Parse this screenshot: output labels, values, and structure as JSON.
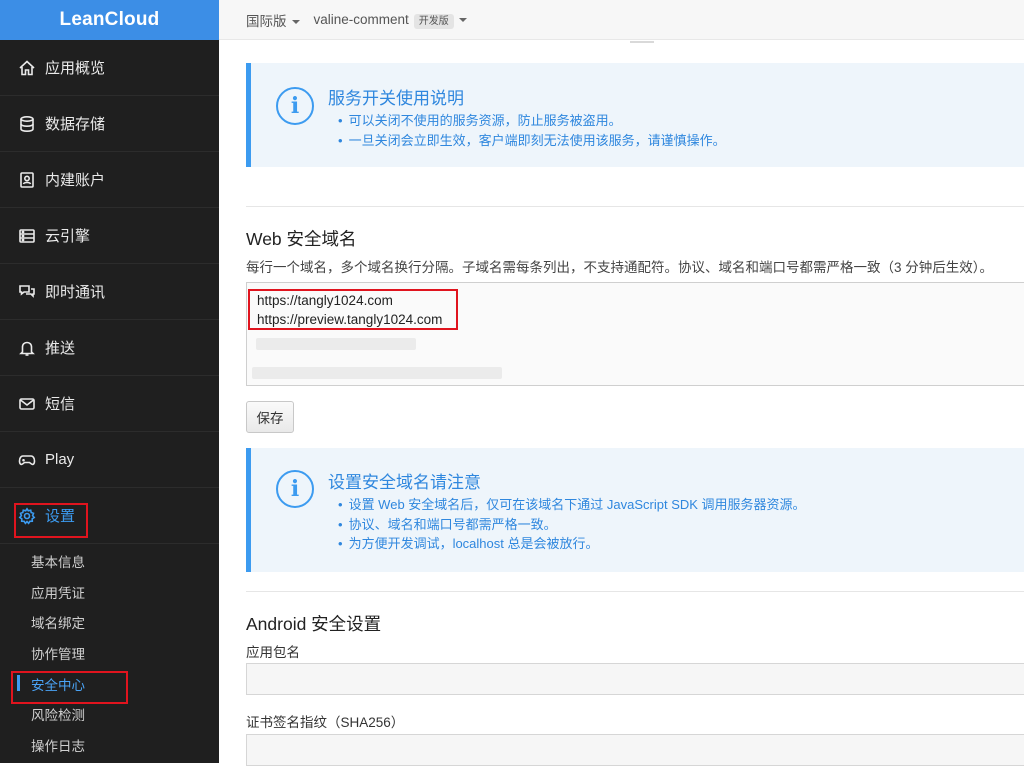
{
  "brand": "LeanCloud",
  "sidebar": {
    "items": [
      {
        "label": "应用概览",
        "icon": "home-icon"
      },
      {
        "label": "数据存储",
        "icon": "database-icon"
      },
      {
        "label": "内建账户",
        "icon": "account-icon"
      },
      {
        "label": "云引擎",
        "icon": "server-icon"
      },
      {
        "label": "即时通讯",
        "icon": "chat-icon"
      },
      {
        "label": "推送",
        "icon": "bell-icon"
      },
      {
        "label": "短信",
        "icon": "mail-icon"
      },
      {
        "label": "Play",
        "icon": "gamepad-icon"
      },
      {
        "label": "设置",
        "icon": "gear-icon"
      }
    ],
    "sub_items": [
      "基本信息",
      "应用凭证",
      "域名绑定",
      "协作管理",
      "安全中心",
      "风险检测",
      "操作日志"
    ],
    "active_item": "设置",
    "active_sub": "安全中心"
  },
  "topbar": {
    "region": "国际版",
    "app_name": "valine-comment",
    "plan_badge": "开发版"
  },
  "service_info": {
    "title": "服务开关使用说明",
    "lines": [
      "可以关闭不使用的服务资源，防止服务被盗用。",
      "一旦关闭会立即生效，客户端即刻无法使用该服务，请谨慎操作。"
    ]
  },
  "web_security": {
    "heading": "Web 安全域名",
    "description": "每行一个域名，多个域名换行分隔。子域名需每条列出，不支持通配符。协议、域名和端口号都需严格一致（3 分钟后生效）。",
    "domains": [
      "https://tangly1024.com",
      "https://preview.tangly1024.com"
    ],
    "save_label": "保存"
  },
  "domain_info": {
    "title": "设置安全域名请注意",
    "lines": [
      "设置 Web 安全域名后，仅可在该域名下通过 JavaScript SDK 调用服务器资源。",
      "协议、域名和端口号都需严格一致。",
      "为方便开发调试，localhost 总是会被放行。"
    ]
  },
  "android_security": {
    "heading": "Android 安全设置",
    "package_label": "应用包名",
    "package_value": "",
    "cert_label": "证书签名指纹（SHA256）",
    "cert_value": ""
  },
  "colors": {
    "accent": "#3c9bf0",
    "sidebar_bg": "#1f1f1f",
    "highlight_red": "#e0141e",
    "info_bg": "#eef5fb"
  }
}
